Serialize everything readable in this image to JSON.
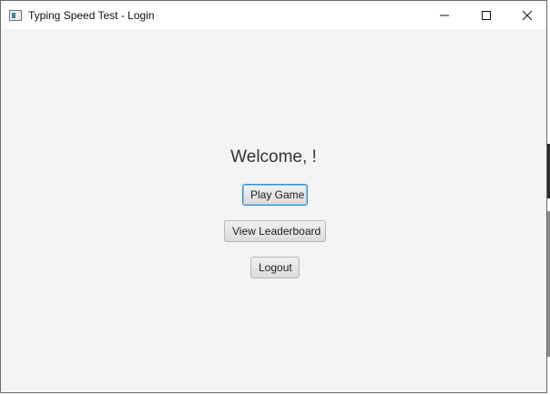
{
  "window": {
    "title": "Typing Speed Test - Login",
    "icon": "app-window-icon"
  },
  "titlebar_controls": {
    "minimize_icon": "minimize-icon",
    "maximize_icon": "maximize-icon",
    "close_icon": "close-icon"
  },
  "main": {
    "welcome_text": "Welcome, !",
    "play_label": "Play Game",
    "leaderboard_label": "View Leaderboard",
    "logout_label": "Logout"
  },
  "colors": {
    "background": "#f4f4f4",
    "focus_border": "#2f8fd6"
  }
}
